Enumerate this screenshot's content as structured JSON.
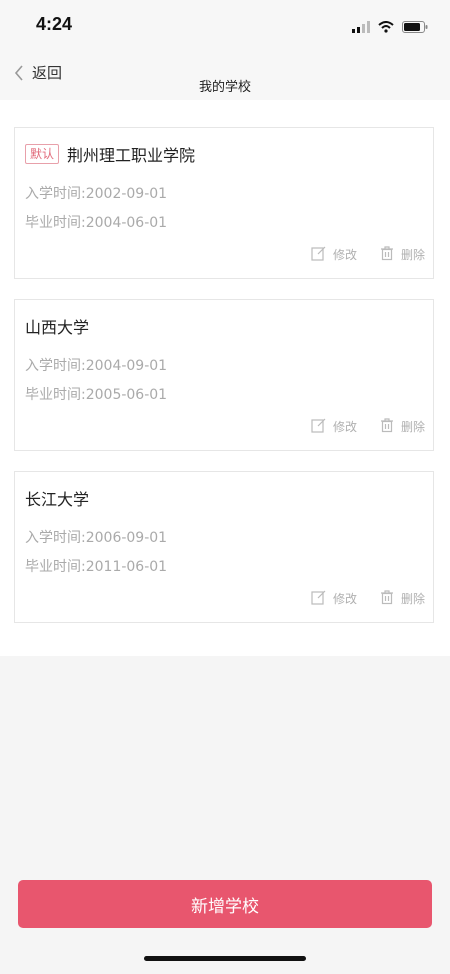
{
  "status_bar": {
    "time": "4:24"
  },
  "nav": {
    "back_label": "返回",
    "title": "我的学校"
  },
  "schools": [
    {
      "is_default": true,
      "default_label": "默认",
      "name": "荆州理工职业学院",
      "enroll": "入学时间:2002-09-01",
      "graduate": "毕业时间:2004-06-01",
      "edit_label": "修改",
      "delete_label": "删除"
    },
    {
      "is_default": false,
      "name": "山西大学",
      "enroll": "入学时间:2004-09-01",
      "graduate": "毕业时间:2005-06-01",
      "edit_label": "修改",
      "delete_label": "删除"
    },
    {
      "is_default": false,
      "name": "长江大学",
      "enroll": "入学时间:2006-09-01",
      "graduate": "毕业时间:2011-06-01",
      "edit_label": "修改",
      "delete_label": "删除"
    }
  ],
  "add_button_label": "新增学校",
  "colors": {
    "accent": "#e8566e",
    "tag": "#e16a7a",
    "muted": "#aaaaaa"
  }
}
